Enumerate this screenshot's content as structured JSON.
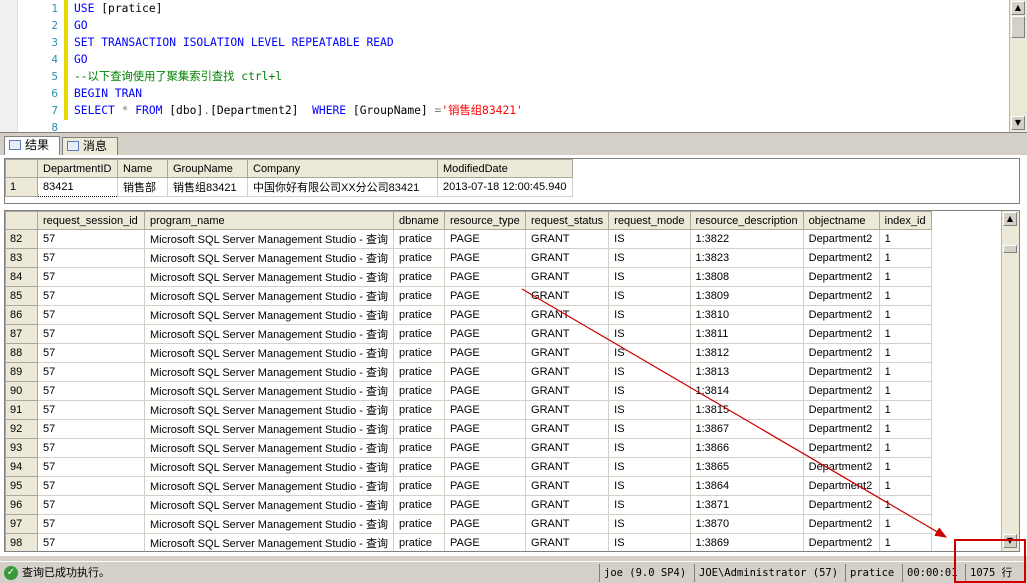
{
  "editor": {
    "lines": [
      {
        "num": "1",
        "parts": [
          {
            "t": "USE ",
            "c": "kw"
          },
          {
            "t": "[pratice]",
            "c": ""
          }
        ]
      },
      {
        "num": "2",
        "parts": [
          {
            "t": "GO",
            "c": "kw"
          }
        ]
      },
      {
        "num": "3",
        "parts": [
          {
            "t": "SET TRANSACTION ISOLATION LEVEL REPEATABLE READ",
            "c": "kw"
          }
        ]
      },
      {
        "num": "4",
        "parts": [
          {
            "t": "GO",
            "c": "kw"
          }
        ]
      },
      {
        "num": "5",
        "parts": [
          {
            "t": "--以下查询使用了聚集索引查找 ctrl+l",
            "c": "cm"
          }
        ]
      },
      {
        "num": "6",
        "parts": [
          {
            "t": "BEGIN TRAN",
            "c": "kw"
          }
        ]
      },
      {
        "num": "7",
        "parts": [
          {
            "t": "SELECT ",
            "c": "kw"
          },
          {
            "t": "* ",
            "c": "gr"
          },
          {
            "t": "FROM ",
            "c": "kw"
          },
          {
            "t": "[dbo]",
            "c": ""
          },
          {
            "t": ".",
            "c": "gr"
          },
          {
            "t": "[Department2]  ",
            "c": ""
          },
          {
            "t": "WHERE ",
            "c": "kw"
          },
          {
            "t": "[GroupName] ",
            "c": ""
          },
          {
            "t": "=",
            "c": "gr"
          },
          {
            "t": "'销售组83421'",
            "c": "st"
          }
        ]
      },
      {
        "num": "8",
        "parts": [
          {
            "t": "",
            "c": ""
          }
        ]
      }
    ]
  },
  "tabs": [
    {
      "label": "结果",
      "icon": "grid-icon",
      "active": true
    },
    {
      "label": "消息",
      "icon": "message-icon",
      "active": false
    }
  ],
  "grid1": {
    "columns": [
      "DepartmentID",
      "Name",
      "GroupName",
      "Company",
      "ModifiedDate"
    ],
    "rows": [
      {
        "rn": "1",
        "cells": [
          "83421",
          "销售部",
          "销售组83421",
          "中国你好有限公司XX分公司83421",
          "2013-07-18 12:00:45.940"
        ]
      }
    ]
  },
  "grid2": {
    "columns": [
      "request_session_id",
      "program_name",
      "dbname",
      "resource_type",
      "request_status",
      "request_mode",
      "resource_description",
      "objectname",
      "index_id"
    ],
    "rows": [
      {
        "rn": "82",
        "cells": [
          "57",
          "Microsoft SQL Server Management Studio - 查询",
          "pratice",
          "PAGE",
          "GRANT",
          "IS",
          "1:3822",
          "Department2",
          "1"
        ]
      },
      {
        "rn": "83",
        "cells": [
          "57",
          "Microsoft SQL Server Management Studio - 查询",
          "pratice",
          "PAGE",
          "GRANT",
          "IS",
          "1:3823",
          "Department2",
          "1"
        ]
      },
      {
        "rn": "84",
        "cells": [
          "57",
          "Microsoft SQL Server Management Studio - 查询",
          "pratice",
          "PAGE",
          "GRANT",
          "IS",
          "1:3808",
          "Department2",
          "1"
        ]
      },
      {
        "rn": "85",
        "cells": [
          "57",
          "Microsoft SQL Server Management Studio - 查询",
          "pratice",
          "PAGE",
          "GRANT",
          "IS",
          "1:3809",
          "Department2",
          "1"
        ]
      },
      {
        "rn": "86",
        "cells": [
          "57",
          "Microsoft SQL Server Management Studio - 查询",
          "pratice",
          "PAGE",
          "GRANT",
          "IS",
          "1:3810",
          "Department2",
          "1"
        ]
      },
      {
        "rn": "87",
        "cells": [
          "57",
          "Microsoft SQL Server Management Studio - 查询",
          "pratice",
          "PAGE",
          "GRANT",
          "IS",
          "1:3811",
          "Department2",
          "1"
        ]
      },
      {
        "rn": "88",
        "cells": [
          "57",
          "Microsoft SQL Server Management Studio - 查询",
          "pratice",
          "PAGE",
          "GRANT",
          "IS",
          "1:3812",
          "Department2",
          "1"
        ]
      },
      {
        "rn": "89",
        "cells": [
          "57",
          "Microsoft SQL Server Management Studio - 查询",
          "pratice",
          "PAGE",
          "GRANT",
          "IS",
          "1:3813",
          "Department2",
          "1"
        ]
      },
      {
        "rn": "90",
        "cells": [
          "57",
          "Microsoft SQL Server Management Studio - 查询",
          "pratice",
          "PAGE",
          "GRANT",
          "IS",
          "1:3814",
          "Department2",
          "1"
        ]
      },
      {
        "rn": "91",
        "cells": [
          "57",
          "Microsoft SQL Server Management Studio - 查询",
          "pratice",
          "PAGE",
          "GRANT",
          "IS",
          "1:3815",
          "Department2",
          "1"
        ]
      },
      {
        "rn": "92",
        "cells": [
          "57",
          "Microsoft SQL Server Management Studio - 查询",
          "pratice",
          "PAGE",
          "GRANT",
          "IS",
          "1:3867",
          "Department2",
          "1"
        ]
      },
      {
        "rn": "93",
        "cells": [
          "57",
          "Microsoft SQL Server Management Studio - 查询",
          "pratice",
          "PAGE",
          "GRANT",
          "IS",
          "1:3866",
          "Department2",
          "1"
        ]
      },
      {
        "rn": "94",
        "cells": [
          "57",
          "Microsoft SQL Server Management Studio - 查询",
          "pratice",
          "PAGE",
          "GRANT",
          "IS",
          "1:3865",
          "Department2",
          "1"
        ]
      },
      {
        "rn": "95",
        "cells": [
          "57",
          "Microsoft SQL Server Management Studio - 查询",
          "pratice",
          "PAGE",
          "GRANT",
          "IS",
          "1:3864",
          "Department2",
          "1"
        ]
      },
      {
        "rn": "96",
        "cells": [
          "57",
          "Microsoft SQL Server Management Studio - 查询",
          "pratice",
          "PAGE",
          "GRANT",
          "IS",
          "1:3871",
          "Department2",
          "1"
        ]
      },
      {
        "rn": "97",
        "cells": [
          "57",
          "Microsoft SQL Server Management Studio - 查询",
          "pratice",
          "PAGE",
          "GRANT",
          "IS",
          "1:3870",
          "Department2",
          "1"
        ]
      },
      {
        "rn": "98",
        "cells": [
          "57",
          "Microsoft SQL Server Management Studio - 查询",
          "pratice",
          "PAGE",
          "GRANT",
          "IS",
          "1:3869",
          "Department2",
          "1"
        ]
      }
    ]
  },
  "status": {
    "message": "查询已成功执行。",
    "server": "joe (9.0 SP4)",
    "user": "JOE\\Administrator (57)",
    "database": "pratice",
    "elapsed": "00:00:01",
    "rows": "1075 行"
  },
  "colors": {
    "annotation": "#cc0000",
    "ok": "#3a9a3a"
  }
}
